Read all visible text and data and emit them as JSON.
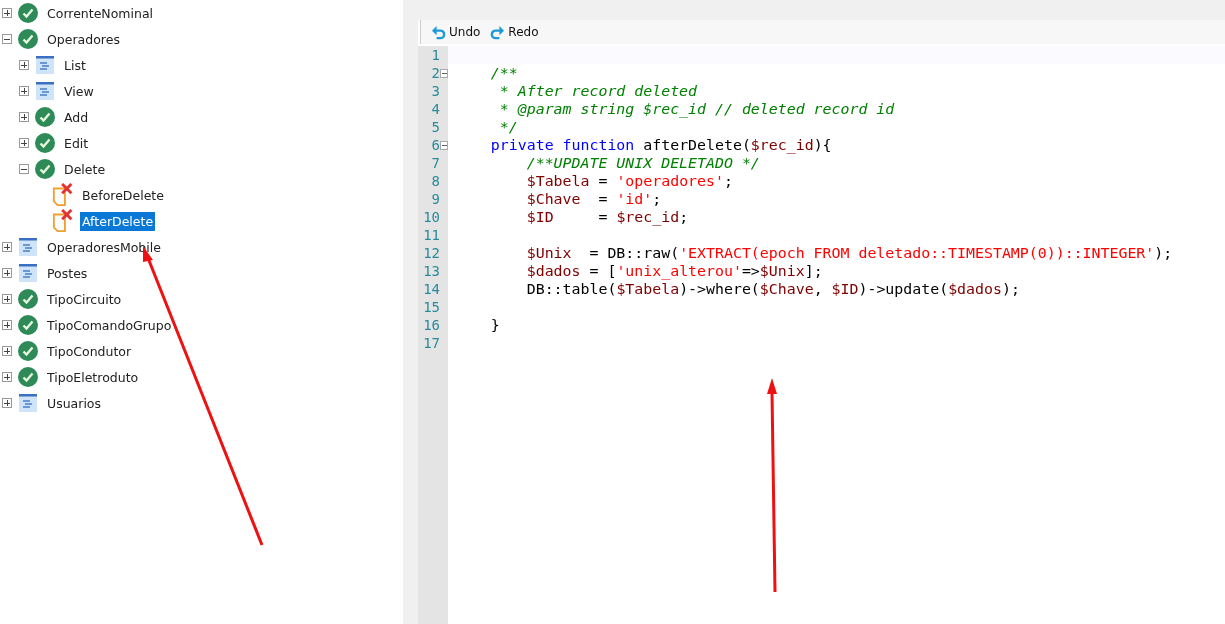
{
  "tree": [
    {
      "label": "CorrenteNominal",
      "kind": "check",
      "expanded": false,
      "selected": false
    },
    {
      "label": "Operadores",
      "kind": "check",
      "expanded": true,
      "selected": false,
      "children": [
        {
          "label": "List",
          "kind": "page",
          "expanded": false,
          "selected": false
        },
        {
          "label": "View",
          "kind": "page",
          "expanded": false,
          "selected": false
        },
        {
          "label": "Add",
          "kind": "check",
          "expanded": false,
          "selected": false
        },
        {
          "label": "Edit",
          "kind": "check",
          "expanded": false,
          "selected": false
        },
        {
          "label": "Delete",
          "kind": "check",
          "expanded": true,
          "selected": false,
          "children": [
            {
              "label": "BeforeDelete",
              "kind": "script",
              "selected": false
            },
            {
              "label": "AfterDelete",
              "kind": "script",
              "selected": true
            }
          ]
        }
      ]
    },
    {
      "label": "OperadoresMobile",
      "kind": "page",
      "expanded": false,
      "selected": false
    },
    {
      "label": "Postes",
      "kind": "page",
      "expanded": false,
      "selected": false
    },
    {
      "label": "TipoCircuito",
      "kind": "check",
      "expanded": false,
      "selected": false
    },
    {
      "label": "TipoComandoGrupo",
      "kind": "check",
      "expanded": false,
      "selected": false
    },
    {
      "label": "TipoCondutor",
      "kind": "check",
      "expanded": false,
      "selected": false
    },
    {
      "label": "TipoEletroduto",
      "kind": "check",
      "expanded": false,
      "selected": false
    },
    {
      "label": "Usuarios",
      "kind": "page",
      "expanded": false,
      "selected": false
    }
  ],
  "toolbar": [
    "Undo",
    "Redo"
  ],
  "code": [
    {
      "number": "1",
      "fold": false
    },
    {
      "number": "2",
      "fold": true,
      "tokens": [
        {
          "kind": "comment",
          "text": "    /**"
        }
      ]
    },
    {
      "number": "3",
      "fold": false,
      "tokens": [
        {
          "kind": "comment",
          "text": "     * After record deleted"
        }
      ]
    },
    {
      "number": "4",
      "fold": false,
      "tokens": [
        {
          "kind": "comment",
          "text": "     * @param string $rec_id // deleted record id"
        }
      ]
    },
    {
      "number": "5",
      "fold": false,
      "tokens": [
        {
          "kind": "comment",
          "text": "     */"
        }
      ]
    },
    {
      "number": "6",
      "fold": true,
      "tokens": [
        {
          "kind": "keyword",
          "text": "    private function "
        },
        {
          "kind": "plain",
          "text": "afterDelete("
        },
        {
          "kind": "var",
          "text": "$rec_id"
        },
        {
          "kind": "plain",
          "text": "){"
        }
      ]
    },
    {
      "number": "7",
      "fold": false,
      "tokens": [
        {
          "kind": "comment",
          "text": "        /**UPDATE UNIX DELETADO */"
        }
      ]
    },
    {
      "number": "8",
      "fold": false,
      "tokens": [
        {
          "kind": "var",
          "text": "        $Tabela"
        },
        {
          "kind": "plain",
          "text": " = "
        },
        {
          "kind": "string",
          "text": "'operadores'"
        },
        {
          "kind": "plain",
          "text": ";"
        }
      ]
    },
    {
      "number": "9",
      "fold": false,
      "tokens": [
        {
          "kind": "var",
          "text": "        $Chave"
        },
        {
          "kind": "plain",
          "text": "  = "
        },
        {
          "kind": "string",
          "text": "'id'"
        },
        {
          "kind": "plain",
          "text": ";"
        }
      ]
    },
    {
      "number": "10",
      "fold": false,
      "tokens": [
        {
          "kind": "var",
          "text": "        $ID"
        },
        {
          "kind": "plain",
          "text": "     = "
        },
        {
          "kind": "var",
          "text": "$rec_id"
        },
        {
          "kind": "plain",
          "text": ";"
        }
      ]
    },
    {
      "number": "11",
      "fold": false
    },
    {
      "number": "12",
      "fold": false,
      "tokens": [
        {
          "kind": "var",
          "text": "        $Unix"
        },
        {
          "kind": "plain",
          "text": "  = DB::raw("
        },
        {
          "kind": "string",
          "text": "'EXTRACT(epoch FROM deletado::TIMESTAMP(0))::INTEGER'"
        },
        {
          "kind": "plain",
          "text": ");"
        }
      ]
    },
    {
      "number": "13",
      "fold": false,
      "tokens": [
        {
          "kind": "var",
          "text": "        $dados"
        },
        {
          "kind": "plain",
          "text": " = ["
        },
        {
          "kind": "string",
          "text": "'unix_alterou'"
        },
        {
          "kind": "plain",
          "text": "=>"
        },
        {
          "kind": "var",
          "text": "$Unix"
        },
        {
          "kind": "plain",
          "text": "];"
        }
      ]
    },
    {
      "number": "14",
      "fold": false,
      "tokens": [
        {
          "kind": "plain",
          "text": "        DB::table("
        },
        {
          "kind": "var",
          "text": "$Tabela"
        },
        {
          "kind": "plain",
          "text": ")->where("
        },
        {
          "kind": "var",
          "text": "$Chave"
        },
        {
          "kind": "plain",
          "text": ", "
        },
        {
          "kind": "var",
          "text": "$ID"
        },
        {
          "kind": "plain",
          "text": ")->update("
        },
        {
          "kind": "var",
          "text": "$dados"
        },
        {
          "kind": "plain",
          "text": ");"
        }
      ]
    },
    {
      "number": "15",
      "fold": false
    },
    {
      "number": "16",
      "fold": false,
      "tokens": [
        {
          "kind": "plain",
          "text": "    }"
        }
      ]
    },
    {
      "number": "17",
      "fold": false
    }
  ]
}
